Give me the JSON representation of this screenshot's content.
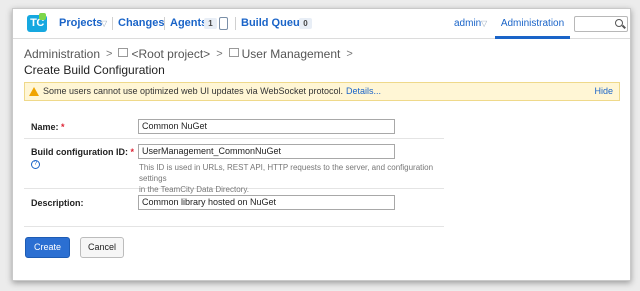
{
  "header": {
    "logo_text": "TC",
    "nav": [
      {
        "label": "Projects"
      },
      {
        "label": "Changes"
      },
      {
        "label": "Agents",
        "count": "1"
      },
      {
        "label": "Build Queue",
        "count": "0"
      }
    ],
    "user": "admin",
    "active_tab": "Administration",
    "search_value": ""
  },
  "breadcrumb": [
    "Administration",
    "<Root project>",
    "User Management"
  ],
  "page_title": "Create Build Configuration",
  "warning": {
    "text": "Some users cannot use optimized web UI updates via WebSocket protocol.",
    "details_link": "Details...",
    "hide_link": "Hide"
  },
  "form": {
    "name_label": "Name:",
    "name_value": "Common NuGet",
    "id_label": "Build configuration ID:",
    "id_value": "UserManagement_CommonNuGet",
    "id_hint_1": "This ID is used in URLs, REST API, HTTP requests to the server, and configuration settings",
    "id_hint_2": "in the TeamCity Data Directory.",
    "description_label": "Description:",
    "description_value": "Common library hosted on NuGet",
    "required_mark": "*",
    "help_mark": "?"
  },
  "buttons": {
    "create": "Create",
    "cancel": "Cancel"
  },
  "colors": {
    "accent": "#1a64c8",
    "primary_button": "#2b6fd2",
    "warning_bg": "#fff6d5",
    "required": "#d23"
  }
}
